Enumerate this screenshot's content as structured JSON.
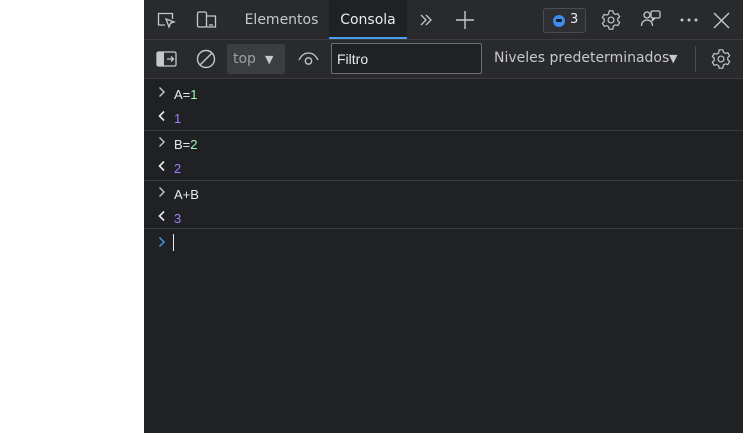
{
  "tabs": [
    {
      "label": "Elementos",
      "active": false
    },
    {
      "label": "Consola",
      "active": true
    }
  ],
  "issues_badge": {
    "count": "3"
  },
  "toolbar": {
    "context": "top",
    "filter_placeholder": "Filtro",
    "levels": "Niveles predeterminados"
  },
  "console": {
    "entries": [
      {
        "kind": "input",
        "var": "A",
        "op": "=",
        "val": "1"
      },
      {
        "kind": "output",
        "text": "1"
      },
      {
        "kind": "input",
        "var": "B",
        "op": "=",
        "val": "2"
      },
      {
        "kind": "output",
        "text": "2"
      },
      {
        "kind": "input",
        "text": "A+B"
      },
      {
        "kind": "output",
        "text": "3"
      }
    ]
  },
  "colors": {
    "panel_bg": "#202124",
    "toolbar_bg": "#292a2d",
    "accent": "#4a9bf0",
    "output_value": "#9980ff",
    "input_number": "#a1f7b5",
    "prompt": "#4a9bf0"
  }
}
